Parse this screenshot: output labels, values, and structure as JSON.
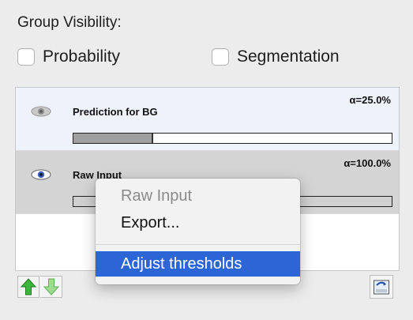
{
  "title": "Group Visibility:",
  "checkboxes": [
    {
      "label": "Probability",
      "checked": false
    },
    {
      "label": "Segmentation",
      "checked": false
    }
  ],
  "layers": [
    {
      "name": "Prediction for BG",
      "alpha": "α=25.0%",
      "opacity": 0.25,
      "selected": false
    },
    {
      "name": "Raw Input",
      "alpha": "α=100.0%",
      "opacity": 1.0,
      "selected": true
    }
  ],
  "context_menu": {
    "header": "Raw Input",
    "items": [
      "Export...",
      "Adjust thresholds"
    ],
    "highlighted": "Adjust thresholds"
  },
  "buttons": {
    "move_up": "arrow-up-green-icon",
    "move_down": "arrow-down-green-icon",
    "export_layer": "export-layer-icon"
  },
  "colors": {
    "menu_highlight": "#2c65d6",
    "arrow_green": "#3db53d",
    "selected_row": "#d4d4d4",
    "first_row": "#eef2fa"
  }
}
